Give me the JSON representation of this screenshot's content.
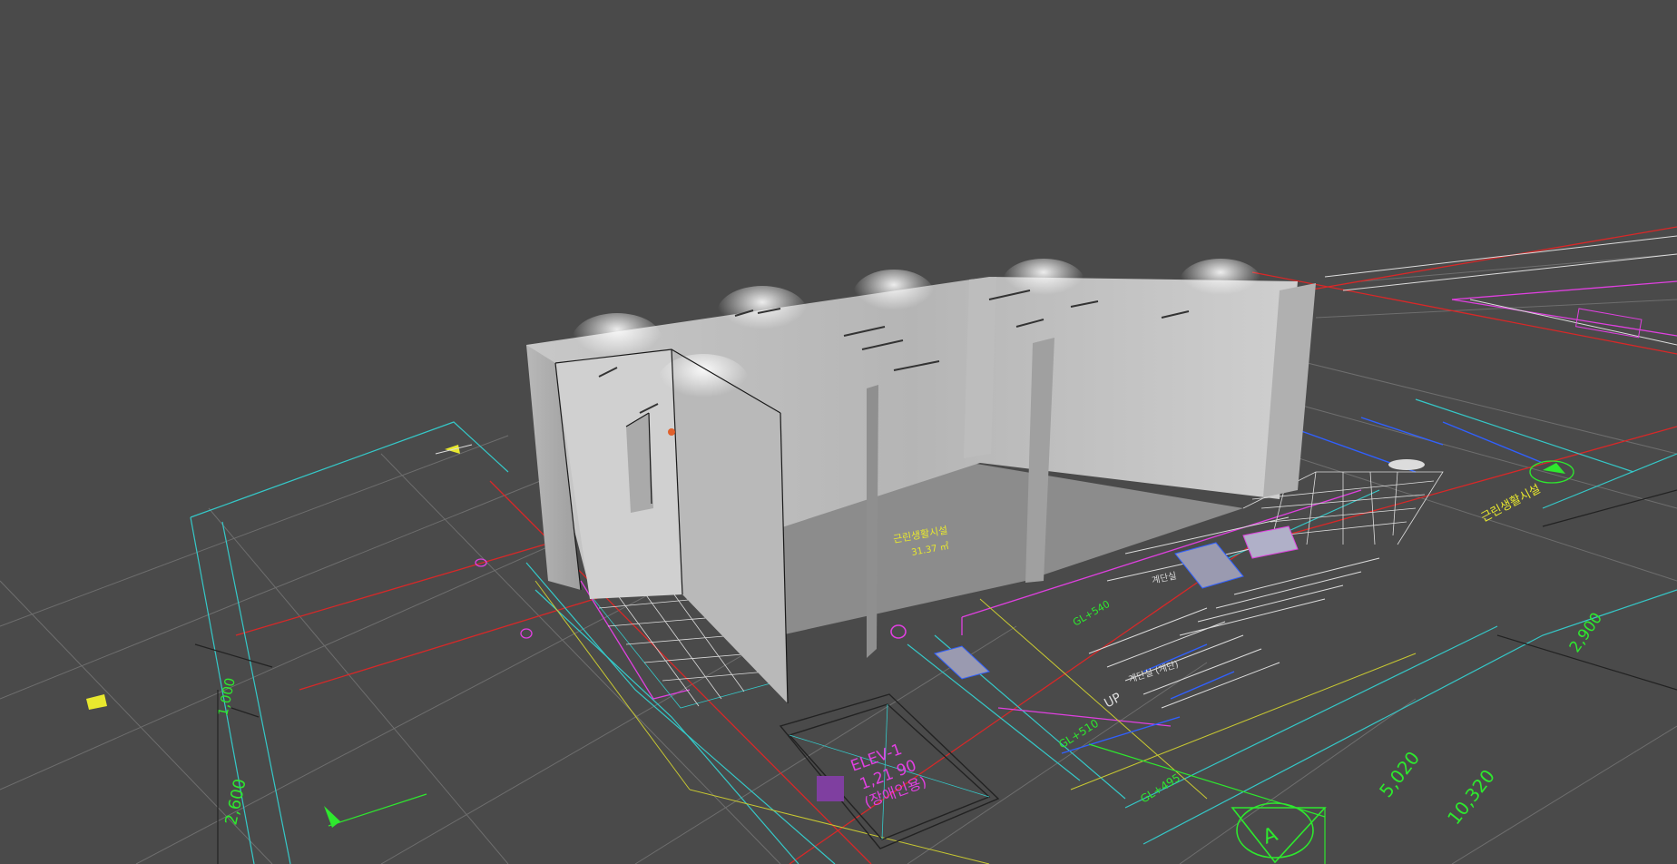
{
  "colors": {
    "background": "#4a4a4a",
    "grid": "#6e6e6e",
    "red_line": "#d82828",
    "cyan_line": "#35c8c8",
    "magenta_line": "#e040e0",
    "green_text": "#2ee82e",
    "yellow_text": "#e8e82e",
    "white_line": "#dcdcdc",
    "blue_line": "#3060ff",
    "wall_light": "#cfcfcf",
    "wall_mid": "#a8a8a8",
    "wall_dark": "#8a8a8a"
  },
  "labels": {
    "elev_name": "ELEV-1",
    "elev_size": "1,21 90",
    "elev_note": "(장애인용)",
    "gl_510": "GL+510",
    "gl_495": "GL+495",
    "gl_540": "GL+540",
    "up_label": "UP",
    "dim_5020": "5,020",
    "dim_10320": "10,320",
    "dim_2900": "2,900",
    "dim_1000": "1,000",
    "dim_2600": "2,600",
    "section_mark": "A",
    "room_label_center": "근린생활시설",
    "room_area_center": "31.37 ㎡",
    "room_label_right": "근린생활시설",
    "room_label_corridor": "계단실",
    "room_label_stair": "계단실 (계단)"
  },
  "icons": {
    "north_arrow": "north-arrow-icon",
    "section_marker": "section-marker-icon"
  }
}
